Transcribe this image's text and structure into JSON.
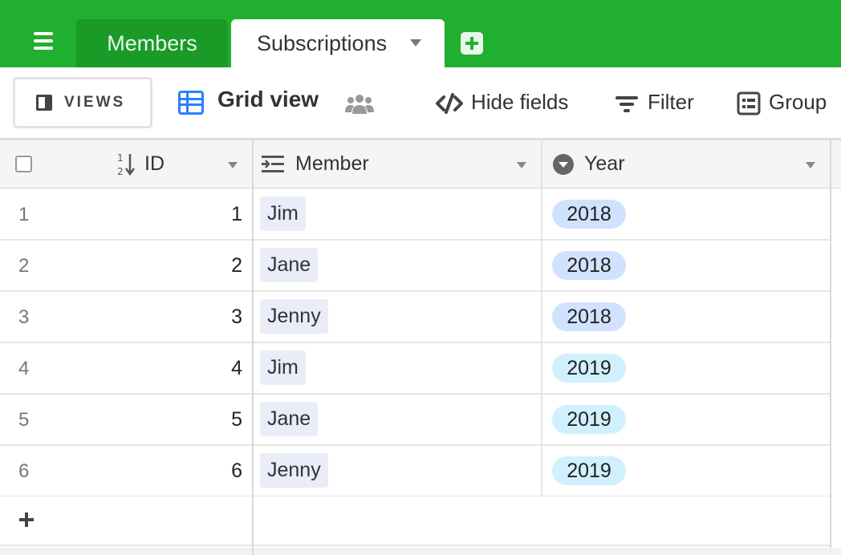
{
  "tabs": {
    "items": [
      {
        "label": "Members",
        "active": false
      },
      {
        "label": "Subscriptions",
        "active": true
      }
    ]
  },
  "toolbar": {
    "views_label": "VIEWS",
    "view_name": "Grid view",
    "hide_fields": "Hide fields",
    "filter": "Filter",
    "group": "Group"
  },
  "columns": {
    "id": "ID",
    "member": "Member",
    "year": "Year"
  },
  "rows": [
    {
      "num": "1",
      "id": "1",
      "member": "Jim",
      "year": "2018"
    },
    {
      "num": "2",
      "id": "2",
      "member": "Jane",
      "year": "2018"
    },
    {
      "num": "3",
      "id": "3",
      "member": "Jenny",
      "year": "2018"
    },
    {
      "num": "4",
      "id": "4",
      "member": "Jim",
      "year": "2019"
    },
    {
      "num": "5",
      "id": "5",
      "member": "Jane",
      "year": "2019"
    },
    {
      "num": "6",
      "id": "6",
      "member": "Jenny",
      "year": "2019"
    }
  ],
  "colors": {
    "brand_green": "#20af2e",
    "accent_blue": "#2d7ff9",
    "year_2018": "#d1e2ff",
    "year_2019": "#d0f0fd"
  }
}
